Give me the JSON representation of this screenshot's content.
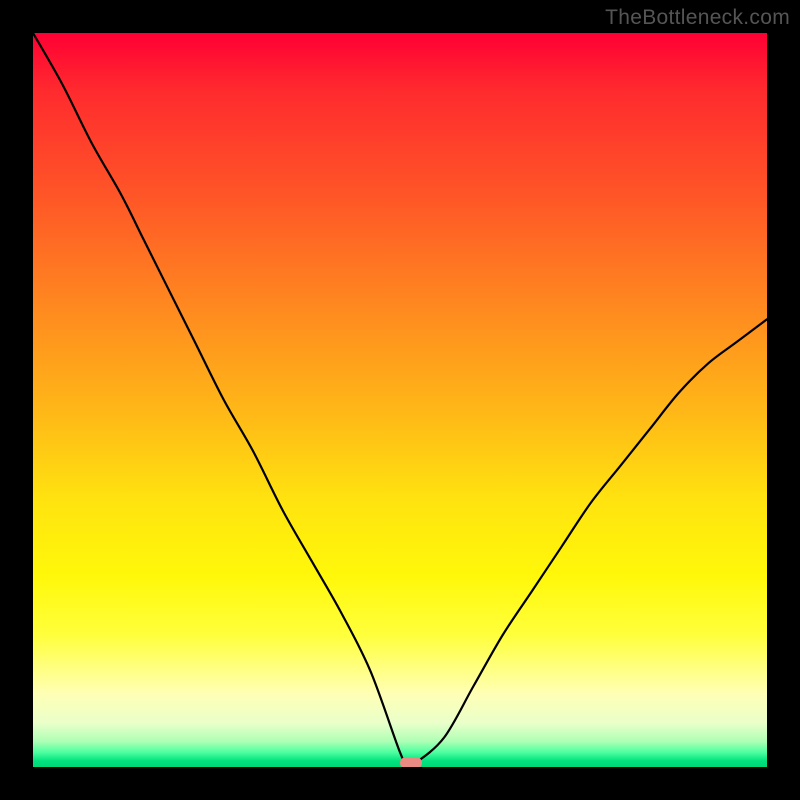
{
  "watermark": "TheBottleneck.com",
  "chart_data": {
    "type": "line",
    "title": "",
    "xlabel": "",
    "ylabel": "",
    "xlim": [
      0,
      100
    ],
    "ylim": [
      0,
      100
    ],
    "grid": false,
    "legend": false,
    "series": [
      {
        "name": "bottleneck-curve",
        "x": [
          0,
          4,
          8,
          12,
          15,
          18,
          22,
          26,
          30,
          34,
          38,
          42,
          46,
          50,
          51,
          52,
          56,
          60,
          64,
          68,
          72,
          76,
          80,
          84,
          88,
          92,
          96,
          100
        ],
        "values": [
          100,
          93,
          85,
          78,
          72,
          66,
          58,
          50,
          43,
          35,
          28,
          21,
          13,
          2,
          0.5,
          0.5,
          4,
          11,
          18,
          24,
          30,
          36,
          41,
          46,
          51,
          55,
          58,
          61
        ]
      }
    ],
    "marker": {
      "x": 51.5,
      "y": 0.5
    },
    "background_gradient": {
      "top": "#ff0034",
      "bottom": "#00d877"
    }
  },
  "plot_css": {
    "inner_left": 33,
    "inner_top": 33,
    "inner_width": 734,
    "inner_height": 734
  }
}
